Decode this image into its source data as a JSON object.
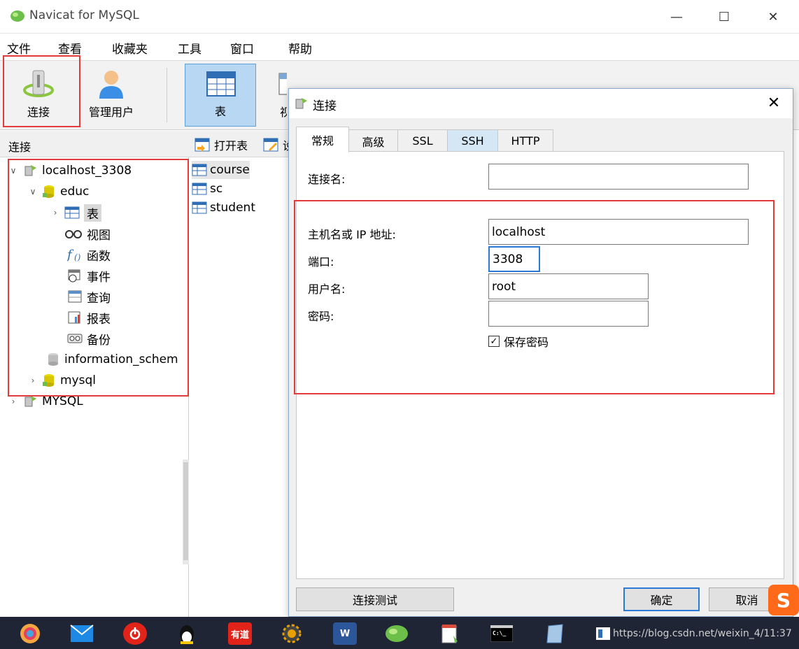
{
  "window": {
    "title": "Navicat for MySQL",
    "minimize": "—",
    "maximize": "☐",
    "close": "✕"
  },
  "menu": [
    "文件",
    "查看",
    "收藏夹",
    "工具",
    "窗口",
    "帮助"
  ],
  "toolbar": {
    "connect": "连接",
    "manage_users": "管理用户",
    "table": "表",
    "view_partial": "视"
  },
  "left_pane": {
    "header": "连接",
    "tree": {
      "connection1": "localhost_3308",
      "db_educ": "educ",
      "node_table": "表",
      "node_view": "视图",
      "node_function": "函数",
      "node_event": "事件",
      "node_query": "查询",
      "node_report": "报表",
      "node_backup": "备份",
      "db_information_schema": "information_schem",
      "db_mysql": "mysql",
      "connection2": "MYSQL"
    }
  },
  "mid_pane": {
    "open_table": "打开表",
    "design_partial": "设",
    "tables": [
      "course",
      "sc",
      "student"
    ]
  },
  "dialog": {
    "title": "连接",
    "close": "✕",
    "tabs": [
      "常规",
      "高级",
      "SSL",
      "SSH",
      "HTTP"
    ],
    "fields": {
      "connection_name_label": "连接名:",
      "connection_name_value": "",
      "host_label": "主机名或 IP 地址:",
      "host_value": "localhost",
      "port_label": "端口:",
      "port_value": "3308",
      "user_label": "用户名:",
      "user_value": "root",
      "password_label": "密码:",
      "password_value": "",
      "save_password": "保存密码",
      "save_password_checked": true
    },
    "buttons": {
      "test": "连接测试",
      "ok": "确定",
      "cancel": "取消"
    }
  },
  "taskbar": {
    "tray_text": "https://blog.csdn.net/weixin_4/11:37",
    "youdao": "有道",
    "word": "W"
  },
  "sogou": "S"
}
